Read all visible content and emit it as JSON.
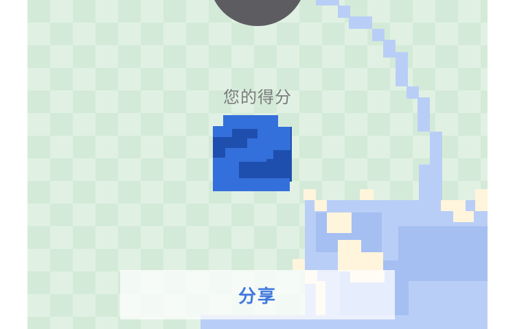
{
  "score": {
    "label": "您的得分",
    "value": "2"
  },
  "share_button": {
    "label": "分享"
  },
  "colors": {
    "board_light": "#e0f1e3",
    "board_dark": "#d4ead8",
    "water": "#b9cef6",
    "water_deep": "#a5bff2",
    "sand": "#fff4dc",
    "score_blue": "#3470db",
    "score_shadow": "#1f4fae",
    "disc": "#5d5d61"
  }
}
